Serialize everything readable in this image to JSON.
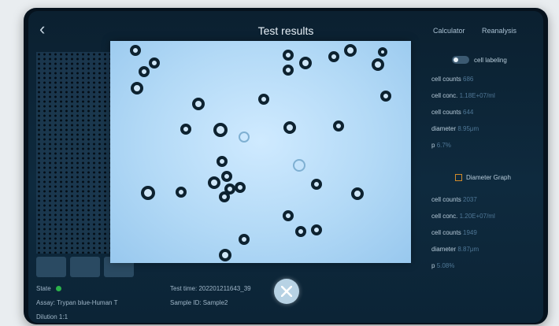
{
  "header": {
    "back_symbol": "‹",
    "title": "Test results",
    "calculator_label": "Calculator",
    "reanalysis_label": "Reanalysis"
  },
  "panel_top": {
    "toggle_label": "cell labeling",
    "rows": [
      {
        "label": "cell counts",
        "value": "686"
      },
      {
        "label": "cell conc.",
        "value": "1.18E+07/ml"
      },
      {
        "label": "cell counts",
        "value": "644"
      },
      {
        "label": "diameter",
        "value": "8.95μm"
      },
      {
        "label": "p",
        "value": "6.7%"
      }
    ]
  },
  "panel_bottom": {
    "checkbox_label": "Diameter Graph",
    "rows": [
      {
        "label": "cell counts",
        "value": "2037"
      },
      {
        "label": "cell conc.",
        "value": "1.20E+07/ml"
      },
      {
        "label": "cell counts",
        "value": "1949"
      },
      {
        "label": "diameter",
        "value": "8.87μm"
      },
      {
        "label": "p",
        "value": "5.08%"
      }
    ]
  },
  "info": {
    "state_label": "State",
    "assay": "Assay: Trypan blue-Human T",
    "dilution": "Dilution 1:1",
    "test_time": "Test time: 202201211643_39",
    "sample_id": "Sample ID: Sample2"
  },
  "colors": {
    "accent_green": "#2bb34a",
    "checkbox_orange": "#d08a2a"
  }
}
